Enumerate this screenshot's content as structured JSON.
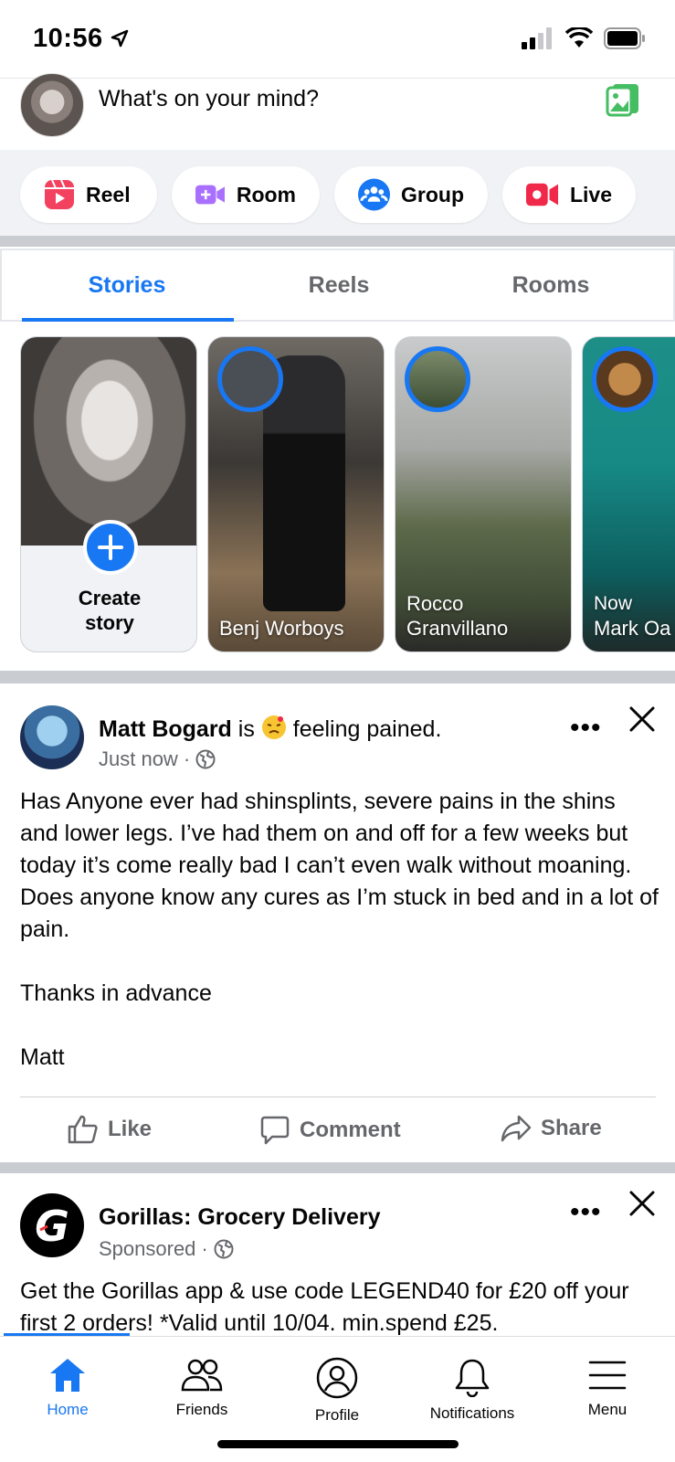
{
  "status_bar": {
    "time": "10:56"
  },
  "composer": {
    "placeholder": "What's on your mind?"
  },
  "quick_actions": [
    {
      "label": "Reel",
      "icon": "reel-icon",
      "color": "#f3425f"
    },
    {
      "label": "Room",
      "icon": "video-plus-icon",
      "color": "#a970ff"
    },
    {
      "label": "Group",
      "icon": "group-icon",
      "color": "#1877f2"
    },
    {
      "label": "Live",
      "icon": "live-video-icon",
      "color": "#f02849"
    }
  ],
  "tabs": [
    {
      "label": "Stories",
      "active": true
    },
    {
      "label": "Reels",
      "active": false
    },
    {
      "label": "Rooms",
      "active": false
    }
  ],
  "stories": {
    "create_label_line1": "Create",
    "create_label_line2": "story",
    "items": [
      {
        "name": "Benj Worboys"
      },
      {
        "name_line1": "Rocco",
        "name_line2": "Granvillano"
      },
      {
        "name_top": "Now",
        "name": "Mark Oa"
      }
    ]
  },
  "post": {
    "author": "Matt Bogard",
    "feeling_prefix": "is",
    "feeling": "feeling pained.",
    "time": "Just now",
    "body": "Has Anyone ever had shinsplints, severe pains in the shins and lower legs. I’ve had them on and off for a few weeks but today it’s come really bad I can’t even walk without moaning. Does anyone know any cures as I’m stuck in bed and in a lot of pain.\n\nThanks in advance\n\nMatt",
    "actions": {
      "like": "Like",
      "comment": "Comment",
      "share": "Share"
    }
  },
  "ad": {
    "title": "Gorillas: Grocery Delivery",
    "sponsored": "Sponsored",
    "body": "Get the Gorillas app & use code LEGEND40 for £20 off your first 2 orders! *Valid until 10/04. min.spend £25."
  },
  "bottom_nav": [
    {
      "label": "Home",
      "active": true
    },
    {
      "label": "Friends",
      "active": false
    },
    {
      "label": "Profile",
      "active": false
    },
    {
      "label": "Notifications",
      "active": false
    },
    {
      "label": "Menu",
      "active": false
    }
  ],
  "colors": {
    "accent": "#1877f2",
    "secondary_text": "#65676b"
  }
}
